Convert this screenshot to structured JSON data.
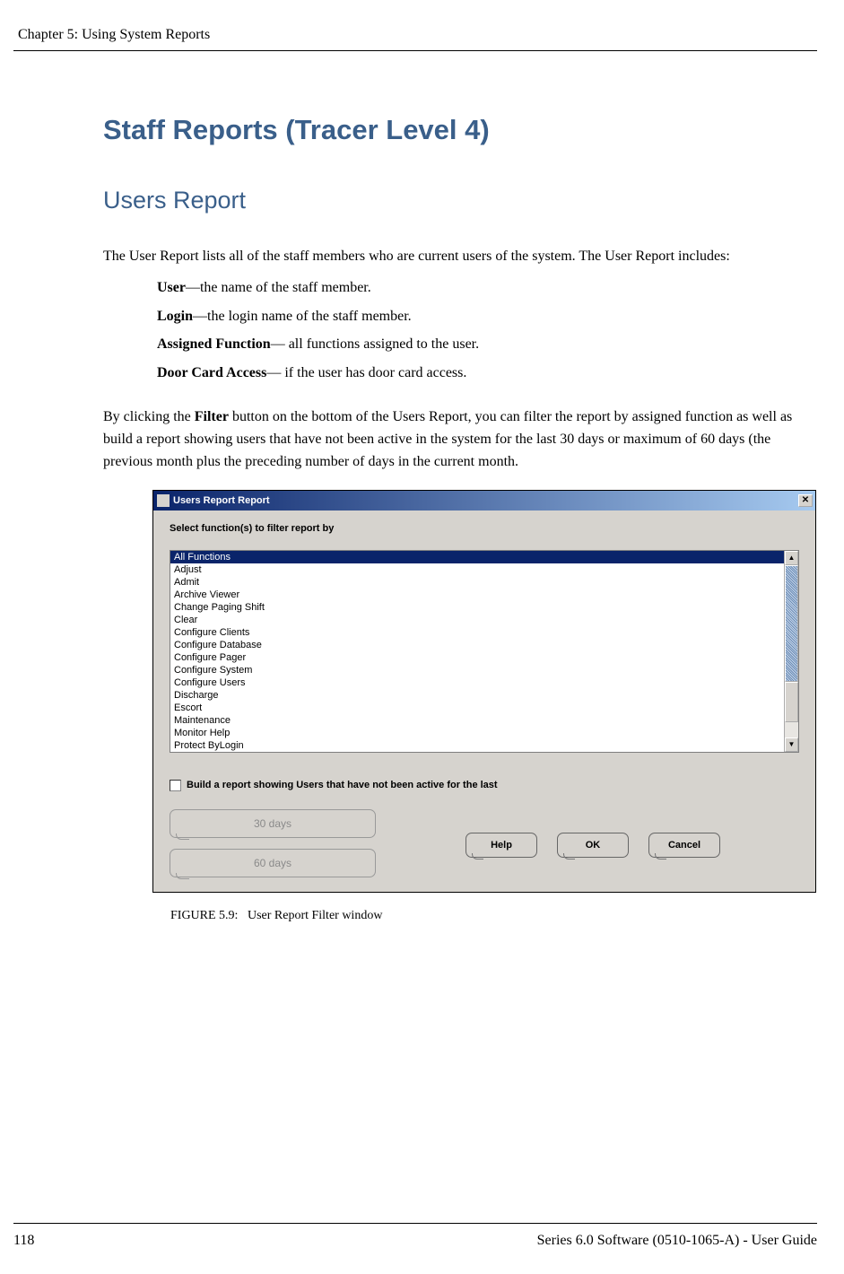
{
  "header": {
    "chapter": "Chapter 5: Using System Reports"
  },
  "headings": {
    "staff": "Staff Reports (Tracer Level 4)",
    "users": "Users Report"
  },
  "intro": "The User Report lists all of the staff members who are current users of the system. The User Report includes:",
  "defs": {
    "user_term": "User",
    "user_text": "—the name of the staff member.",
    "login_term": "Login",
    "login_text": "—the login name of the staff member.",
    "assigned_term": "Assigned Function",
    "assigned_text": "— all functions assigned to the user.",
    "door_term": "Door Card Access",
    "door_text": "— if the user has door card access."
  },
  "paragraph": {
    "prefix": "By clicking the ",
    "bold": "Filter",
    "suffix": " button on the bottom of the Users Report, you can filter the report by assigned function as well as build a report showing users that have not been active in the system for the last 30 days or maximum of 60 days (the previous month plus the preceding number of days in the current month."
  },
  "dialog": {
    "title": "Users Report Report",
    "select_label": "Select function(s) to filter report by",
    "functions": [
      "All Functions",
      "Adjust",
      "Admit",
      "Archive Viewer",
      "Change Paging Shift",
      "Clear",
      "Configure Clients",
      "Configure Database",
      "Configure Pager",
      "Configure System",
      "Configure Users",
      "Discharge",
      "Escort",
      "Maintenance",
      "Monitor Help",
      "Protect ByLogin"
    ],
    "checkbox_label": "Build a report showing Users that have not been active for the last",
    "btn_30": "30 days",
    "btn_60": "60 days",
    "btn_help": "Help",
    "btn_ok": "OK",
    "btn_cancel": "Cancel"
  },
  "figure_caption": {
    "label": "FIGURE 5.9:",
    "text": "User Report Filter window"
  },
  "footer": {
    "page": "118",
    "guide": "Series 6.0 Software (0510-1065-A) - User Guide"
  }
}
